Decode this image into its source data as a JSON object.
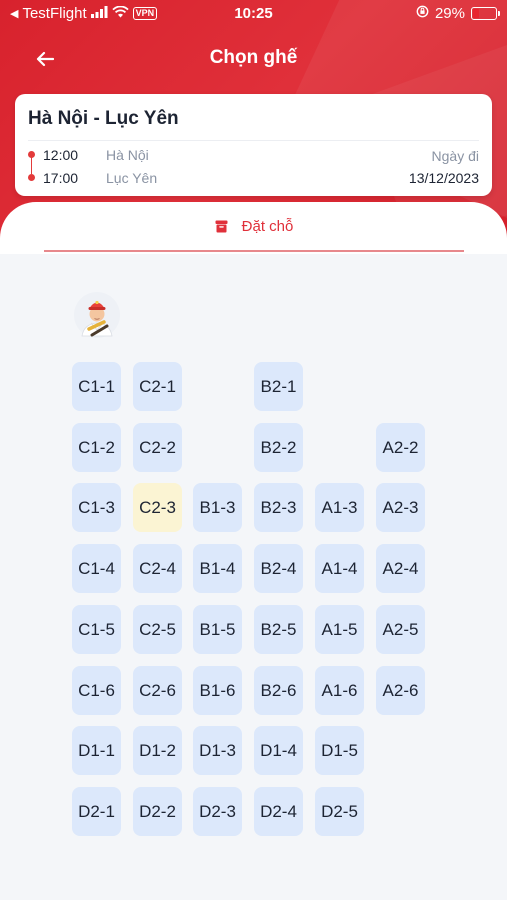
{
  "status_bar": {
    "carrier": "TestFlight",
    "vpn": "VPN",
    "time": "10:25",
    "battery": "29%",
    "battery_level": 0.29
  },
  "nav": {
    "title": "Chọn ghế"
  },
  "trip": {
    "route": "Hà Nội - Lục Yên",
    "departure_time": "12:00",
    "departure_stop": "Hà Nội",
    "arrival_time": "17:00",
    "arrival_stop": "Lục Yên",
    "date_label": "Ngày đi",
    "date": "13/12/2023"
  },
  "tab": {
    "label": "Đặt chỗ"
  },
  "colors": {
    "brand": "#e0303a",
    "seat_available": "#dce8fb",
    "seat_selected": "#fbf4d3"
  },
  "seats": [
    {
      "id": "C1-1",
      "col": 0,
      "row": 0
    },
    {
      "id": "C2-1",
      "col": 1,
      "row": 0
    },
    {
      "id": "B2-1",
      "col": 3,
      "row": 0
    },
    {
      "id": "C1-2",
      "col": 0,
      "row": 1
    },
    {
      "id": "C2-2",
      "col": 1,
      "row": 1
    },
    {
      "id": "B2-2",
      "col": 3,
      "row": 1
    },
    {
      "id": "A2-2",
      "col": 5,
      "row": 1
    },
    {
      "id": "C1-3",
      "col": 0,
      "row": 2
    },
    {
      "id": "C2-3",
      "col": 1,
      "row": 2,
      "selected": true
    },
    {
      "id": "B1-3",
      "col": 2,
      "row": 2
    },
    {
      "id": "B2-3",
      "col": 3,
      "row": 2
    },
    {
      "id": "A1-3",
      "col": 4,
      "row": 2
    },
    {
      "id": "A2-3",
      "col": 5,
      "row": 2
    },
    {
      "id": "C1-4",
      "col": 0,
      "row": 3
    },
    {
      "id": "C2-4",
      "col": 1,
      "row": 3
    },
    {
      "id": "B1-4",
      "col": 2,
      "row": 3
    },
    {
      "id": "B2-4",
      "col": 3,
      "row": 3
    },
    {
      "id": "A1-4",
      "col": 4,
      "row": 3
    },
    {
      "id": "A2-4",
      "col": 5,
      "row": 3
    },
    {
      "id": "C1-5",
      "col": 0,
      "row": 4
    },
    {
      "id": "C2-5",
      "col": 1,
      "row": 4
    },
    {
      "id": "B1-5",
      "col": 2,
      "row": 4
    },
    {
      "id": "B2-5",
      "col": 3,
      "row": 4
    },
    {
      "id": "A1-5",
      "col": 4,
      "row": 4
    },
    {
      "id": "A2-5",
      "col": 5,
      "row": 4
    },
    {
      "id": "C1-6",
      "col": 0,
      "row": 5
    },
    {
      "id": "C2-6",
      "col": 1,
      "row": 5
    },
    {
      "id": "B1-6",
      "col": 2,
      "row": 5
    },
    {
      "id": "B2-6",
      "col": 3,
      "row": 5
    },
    {
      "id": "A1-6",
      "col": 4,
      "row": 5
    },
    {
      "id": "A2-6",
      "col": 5,
      "row": 5
    },
    {
      "id": "D1-1",
      "col": 0,
      "row": 6
    },
    {
      "id": "D1-2",
      "col": 1,
      "row": 6
    },
    {
      "id": "D1-3",
      "col": 2,
      "row": 6
    },
    {
      "id": "D1-4",
      "col": 3,
      "row": 6
    },
    {
      "id": "D1-5",
      "col": 4,
      "row": 6
    },
    {
      "id": "D2-1",
      "col": 0,
      "row": 7
    },
    {
      "id": "D2-2",
      "col": 1,
      "row": 7
    },
    {
      "id": "D2-3",
      "col": 2,
      "row": 7
    },
    {
      "id": "D2-4",
      "col": 3,
      "row": 7
    },
    {
      "id": "D2-5",
      "col": 4,
      "row": 7
    }
  ]
}
